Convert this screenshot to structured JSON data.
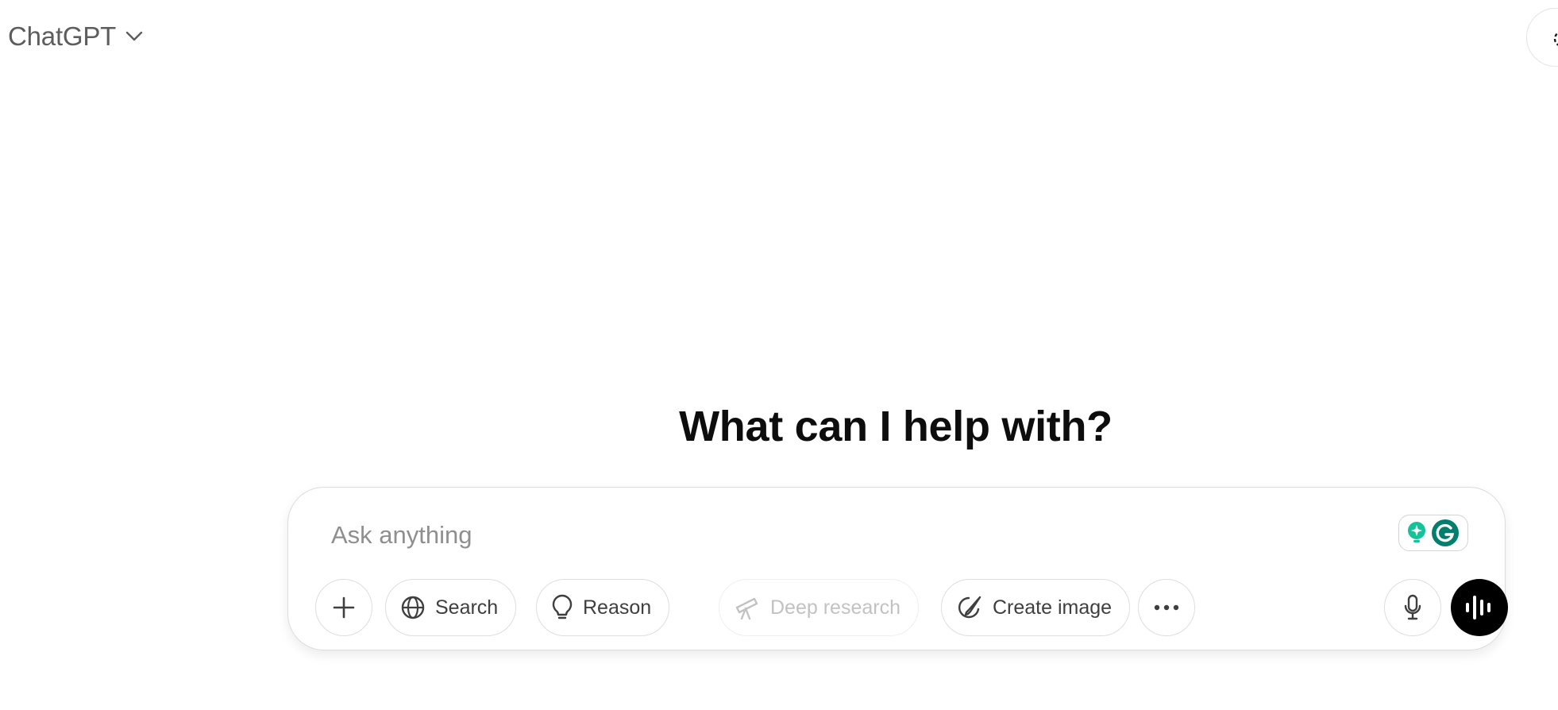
{
  "header": {
    "model_name": "ChatGPT"
  },
  "main": {
    "heading": "What can I help with?"
  },
  "composer": {
    "placeholder": "Ask anything",
    "value": "",
    "tools": {
      "search_label": "Search",
      "reason_label": "Reason",
      "deep_research_label": "Deep research",
      "create_image_label": "Create image"
    }
  },
  "icons": {
    "model_dropdown": "chevron-down-icon",
    "attach": "plus-icon",
    "search": "globe-icon",
    "reason": "lightbulb-icon",
    "deep_research": "telescope-icon",
    "create_image": "paintbrush-icon",
    "more": "ellipsis-icon",
    "mic": "microphone-icon",
    "voice": "voice-waveform-icon",
    "grammarly": "grammarly-icon",
    "top_right": "chat-bubble-icon"
  },
  "colors": {
    "background": "#ffffff",
    "heading": "#0d0d0d",
    "model_name": "#5d5d5d",
    "placeholder": "#8f8f8f",
    "pill_text": "#3f3f3f",
    "disabled_text": "#c2c2c2",
    "voice_button": "#000000",
    "grammarly_green": "#15c39a",
    "grammarly_dark": "#027e6f"
  }
}
